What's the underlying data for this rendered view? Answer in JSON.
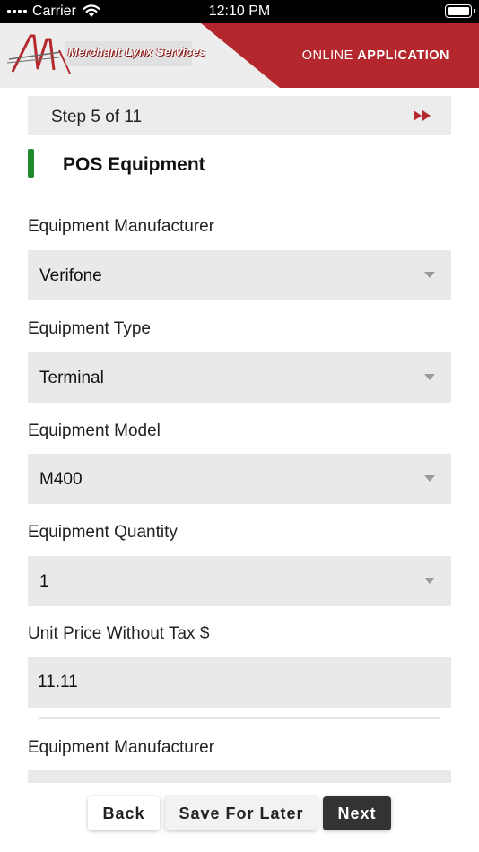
{
  "status_bar": {
    "carrier": "Carrier",
    "time": "12:10 PM"
  },
  "header": {
    "logo_text": "Merchant Lynx Services",
    "title_part1": "ONLINE",
    "title_part2": "APPLICATION",
    "brand_color": "#b3272d"
  },
  "step": {
    "label": "Step 5 of 11",
    "icon": "fast-forward-icon"
  },
  "section": {
    "title": "POS Equipment",
    "marker_color": "#1f8a2c"
  },
  "form": {
    "fields": [
      {
        "label": "Equipment Manufacturer",
        "value": "Verifone"
      },
      {
        "label": "Equipment Type",
        "value": "Terminal"
      },
      {
        "label": "Equipment Model",
        "value": "M400"
      },
      {
        "label": "Equipment Quantity",
        "value": "1"
      }
    ],
    "unit_price": {
      "label": "Unit Price Without Tax $",
      "value": "11.11"
    },
    "next_group_label": "Equipment Manufacturer"
  },
  "buttons": {
    "back": "Back",
    "save": "Save For Later",
    "next": "Next"
  }
}
